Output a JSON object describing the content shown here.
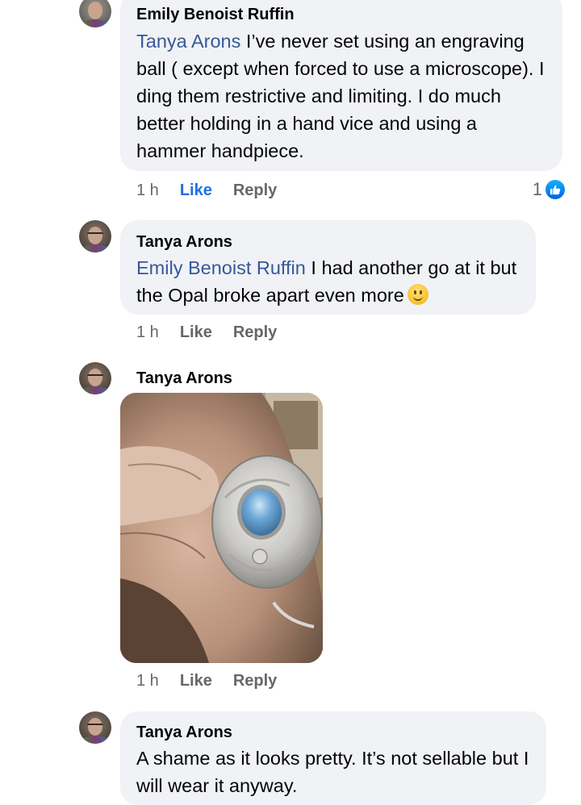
{
  "comments": [
    {
      "author": "Emily Benoist Ruffin",
      "mention": "Tanya Arons",
      "text": " I’ve never set using an engraving ball ( except when forced to use a microscope). I ding them restrictive and limiting. I do much better holding in a hand vice and using a hammer handpiece.",
      "time": "1 h",
      "like_label": "Like",
      "reply_label": "Reply",
      "reaction_count": "1",
      "liked": true
    },
    {
      "author": "Tanya Arons",
      "mention": "Emily Benoist Ruffin",
      "text": " I had another go at it but the Opal broke apart even more",
      "emoji": "slightly-smiling-face",
      "time": "1 h",
      "like_label": "Like",
      "reply_label": "Reply"
    },
    {
      "author": "Tanya Arons",
      "image": "photo of a silver ring with blue opal held between fingers",
      "time": "1 h",
      "like_label": "Like",
      "reply_label": "Reply"
    },
    {
      "author": "Tanya Arons",
      "text": "A shame as it looks pretty.  It’s not sellable but I will wear it anyway."
    }
  ],
  "colors": {
    "bubble": "#f0f2f5",
    "mention": "#385898",
    "meta": "#65676b",
    "like_active": "#216fdb"
  }
}
